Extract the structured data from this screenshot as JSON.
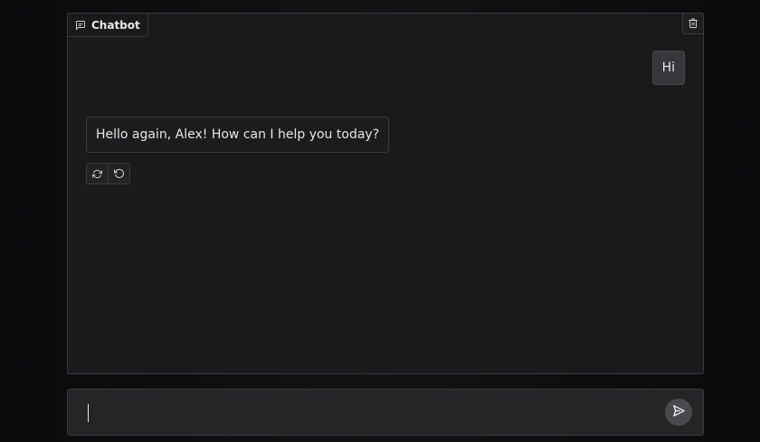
{
  "chatbot": {
    "label": "Chatbot",
    "label_icon": "chat-icon",
    "clear_icon": "trash-icon"
  },
  "messages": [
    {
      "role": "user",
      "text": "Hi"
    },
    {
      "role": "assistant",
      "text": "Hello again, Alex! How can I help you today?"
    }
  ],
  "message_actions": [
    {
      "icon": "retry-icon"
    },
    {
      "icon": "undo-icon"
    }
  ],
  "composer": {
    "value": "",
    "placeholder": "",
    "send_icon": "send-icon"
  }
}
